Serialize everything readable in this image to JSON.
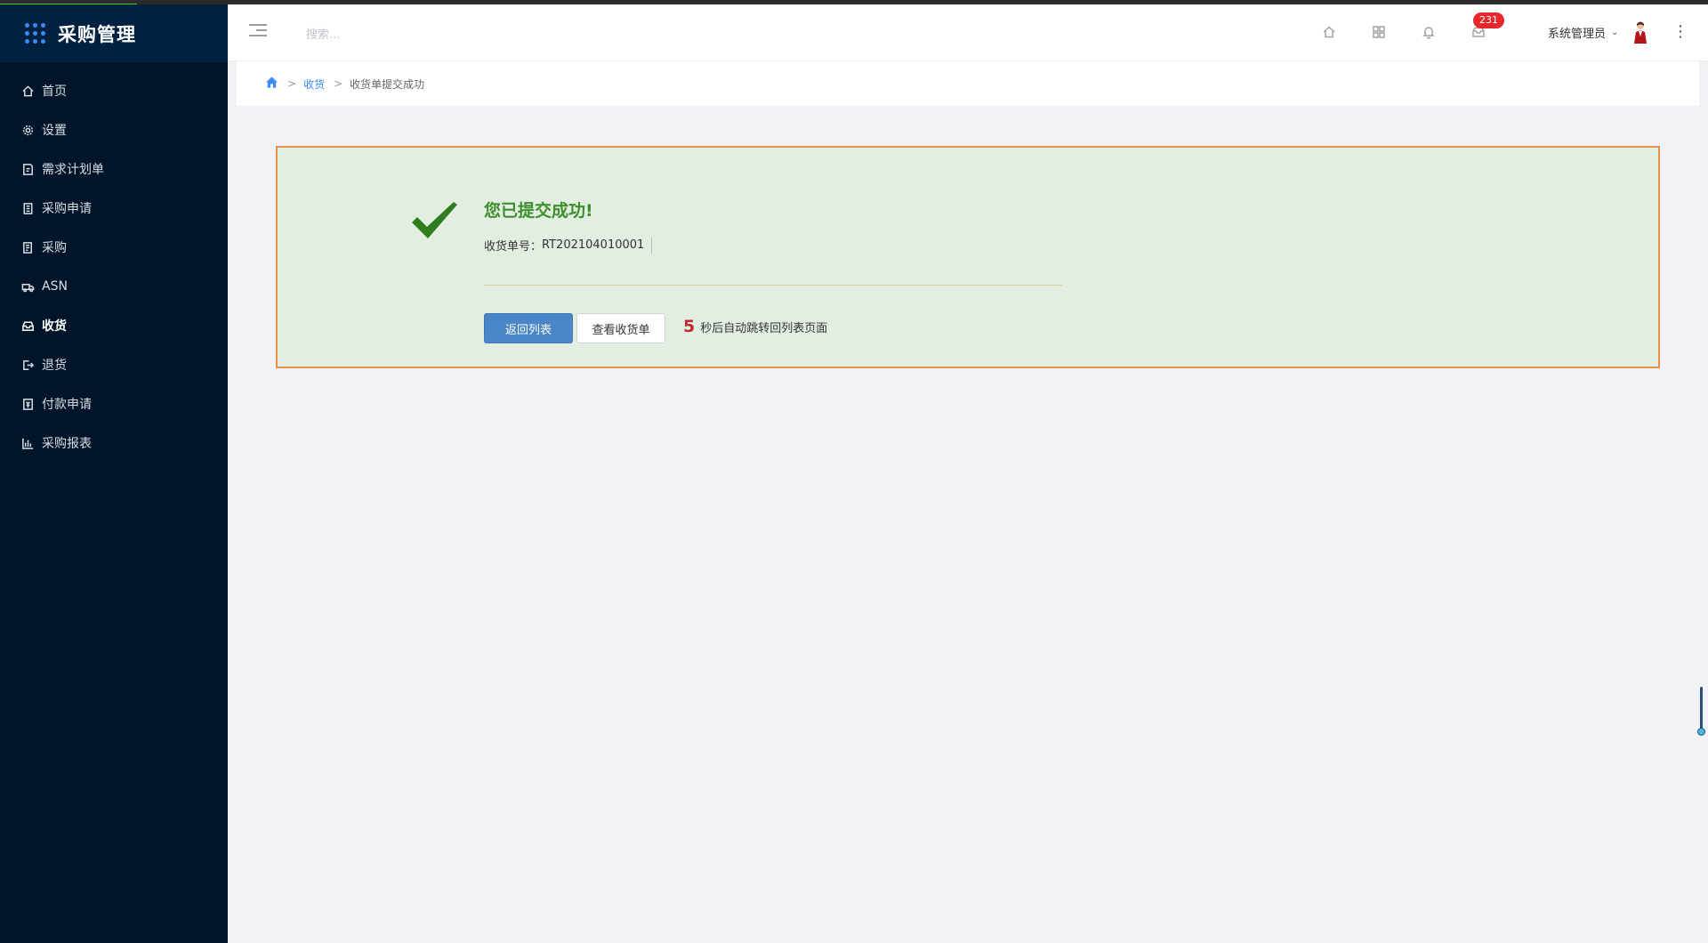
{
  "app": {
    "title": "采购管理"
  },
  "sidebar": {
    "items": [
      {
        "label": "首页",
        "icon": "home-icon"
      },
      {
        "label": "设置",
        "icon": "gear-icon"
      },
      {
        "label": "需求计划单",
        "icon": "document-edit-icon"
      },
      {
        "label": "采购申请",
        "icon": "clipboard-icon"
      },
      {
        "label": "采购",
        "icon": "list-document-icon"
      },
      {
        "label": "ASN",
        "icon": "truck-icon"
      },
      {
        "label": "收货",
        "icon": "inbox-icon",
        "active": true
      },
      {
        "label": "退货",
        "icon": "exit-icon"
      },
      {
        "label": "付款申请",
        "icon": "payment-icon"
      },
      {
        "label": "采购报表",
        "icon": "bar-chart-icon"
      }
    ]
  },
  "header": {
    "search_placeholder": "搜索...",
    "message_badge": "231",
    "user_name": "系统管理员"
  },
  "breadcrumb": {
    "parent": "收货",
    "current": "收货单提交成功"
  },
  "result": {
    "title": "您已提交成功!",
    "order_label": "收货单号：",
    "order_number": "RT202104010001",
    "back_button": "返回列表",
    "view_button": "查看收货单",
    "countdown_seconds": "5",
    "countdown_text": "秒后自动跳转回列表页面"
  },
  "colors": {
    "sidebar_bg": "#001529",
    "accent_blue": "#3a8bf7",
    "success_green": "#3c8f2b",
    "success_bg": "#e3eee2",
    "box_border": "#e8914a",
    "badge_red": "#e8262d"
  }
}
